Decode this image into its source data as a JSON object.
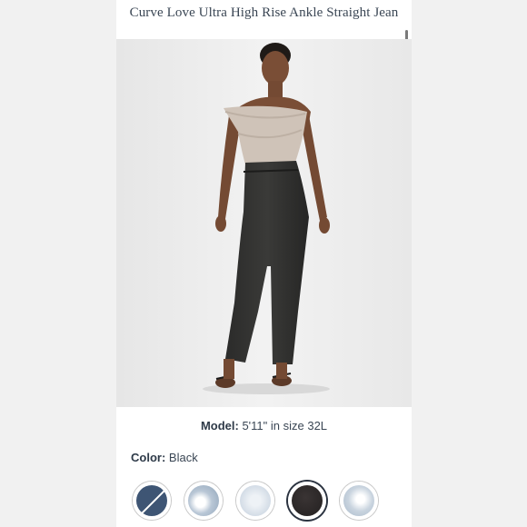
{
  "product": {
    "title": "Curve Love Ultra High Rise Ankle Straight Jean"
  },
  "model": {
    "label": "Model:",
    "value": "5'11\" in size 32L"
  },
  "color": {
    "label": "Color:",
    "value": "Black"
  },
  "swatches": [
    {
      "name": "dark-wash-unavailable",
      "color": "#3e5574",
      "unavailable": true
    },
    {
      "name": "light-destroyed-wash",
      "color": "#b9c7d6"
    },
    {
      "name": "bleached-light-wash",
      "color": "#d3dce6"
    },
    {
      "name": "black",
      "color": "#2a2626",
      "selected": true
    },
    {
      "name": "light-ripped-wash",
      "color": "#c9d4df"
    }
  ],
  "colors": {
    "background": "#f1f1f1",
    "panel": "#ffffff",
    "text": "#3a4654",
    "selected_ring": "#2b3340"
  }
}
